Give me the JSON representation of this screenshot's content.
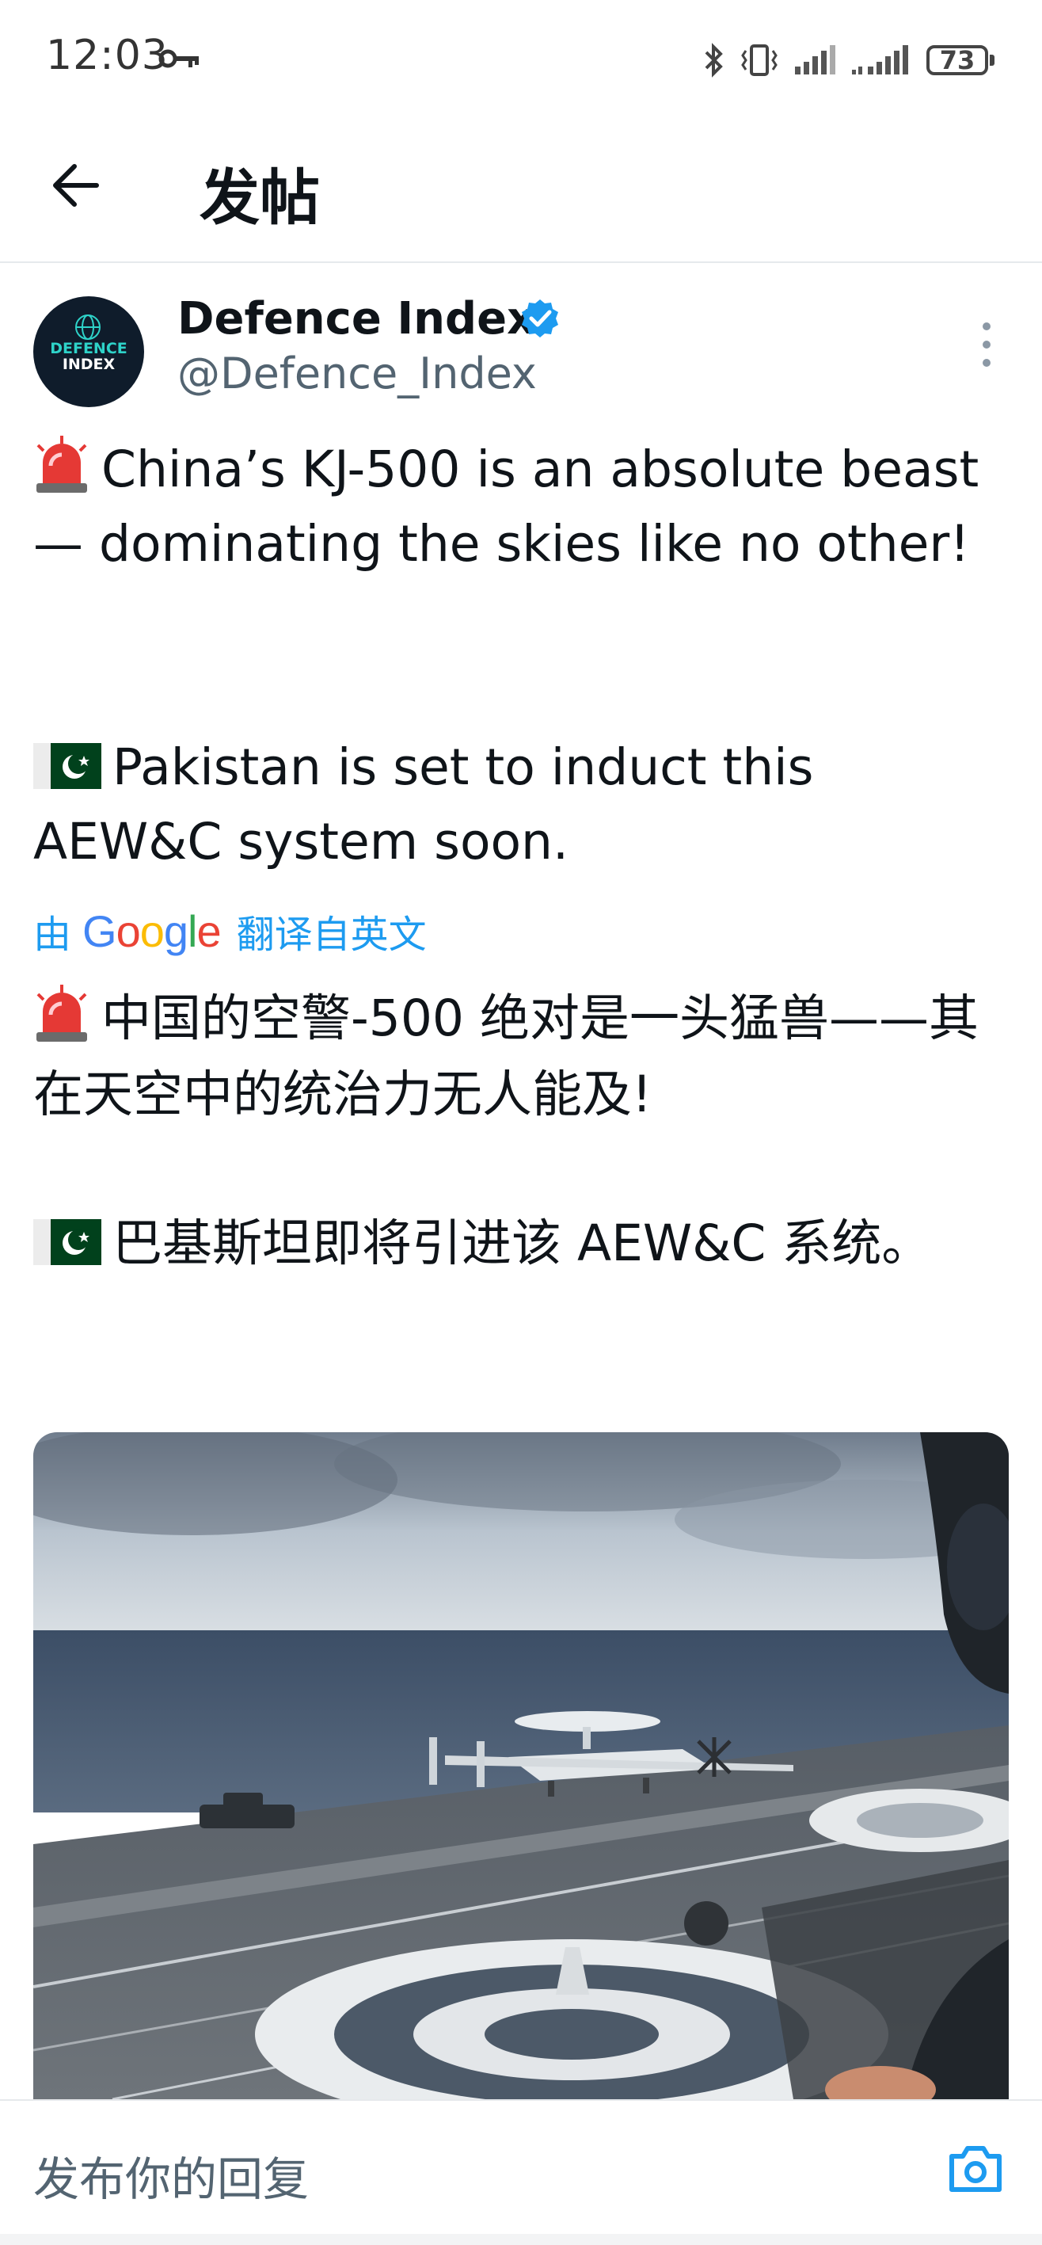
{
  "status_bar": {
    "time": "12:03",
    "battery": "73",
    "icons": [
      "key-icon",
      "bluetooth-icon",
      "vibrate-icon",
      "signal-icon",
      "signal-icon"
    ]
  },
  "header": {
    "title": "发帖",
    "back_icon": "back-arrow-icon"
  },
  "post": {
    "author": {
      "display_name": "Defence Index",
      "handle": "@Defence_Index",
      "avatar_text": [
        "DEFENCE",
        "INDEX"
      ]
    },
    "original_text": {
      "line1": "China’s KJ-500 is an absolute beast — dominating the skies like no other!",
      "line2": "Pakistan is set to induct this AEW&C system soon."
    },
    "translation": {
      "prefix": "由",
      "provider": "Google",
      "suffix": "翻译自英文"
    },
    "translated_text": {
      "line1": "中国的空警-500 绝对是一头猛兽——其在天空中的统治力无人能及!",
      "line2": "巴基斯坦即将引进该 AEW&C 系统。"
    },
    "media": {
      "type": "video-still"
    }
  },
  "reply_bar": {
    "placeholder": "发布你的回复",
    "camera_icon": "camera-icon"
  },
  "colors": {
    "accent": "#1d9bf0",
    "text": "#0f1419",
    "muted": "#536471",
    "flag_green": "#01411c"
  }
}
